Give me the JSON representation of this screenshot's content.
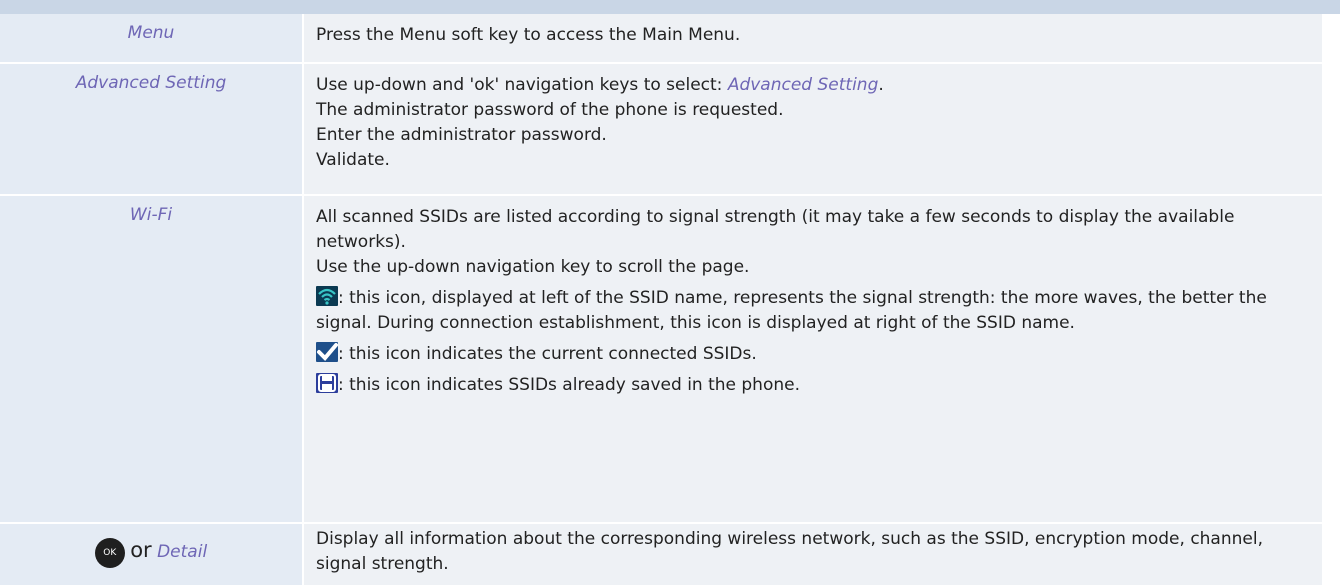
{
  "rows": [
    {
      "key": "Menu",
      "lines": [
        "Press the Menu soft key to access the Main Menu."
      ]
    },
    {
      "key": "Advanced Setting",
      "line1_prefix": "Use up-down and 'ok' navigation keys to select: ",
      "line1_em": "Advanced Setting",
      "line1_suffix": ".",
      "lines": [
        "The administrator password of the phone is requested.",
        "Enter the administrator password.",
        "Validate."
      ]
    },
    {
      "key": "Wi-Fi",
      "p1": "All scanned SSIDs are listed according to signal strength (it may take a few seconds to display the available networks).",
      "p2": "Use the up-down navigation key to scroll the page.",
      "wifi_icon": "wifi-signal-icon",
      "wifi_text": ": this icon, displayed at left of the SSID name, represents the signal strength: the more waves, the better the signal. During connection establishment, this icon is displayed at right of the SSID name.",
      "check_icon": "checkmark-icon",
      "check_text": ": this icon indicates the current connected SSIDs.",
      "save_icon": "floppy-disk-icon",
      "save_text": ": this icon indicates SSIDs already saved in the phone."
    },
    {
      "ok_label": "OK",
      "or_text": "or",
      "key": "Detail",
      "text": "Display all information about the corresponding wireless network, such as the SSID, encryption mode, channel, signal strength."
    }
  ]
}
